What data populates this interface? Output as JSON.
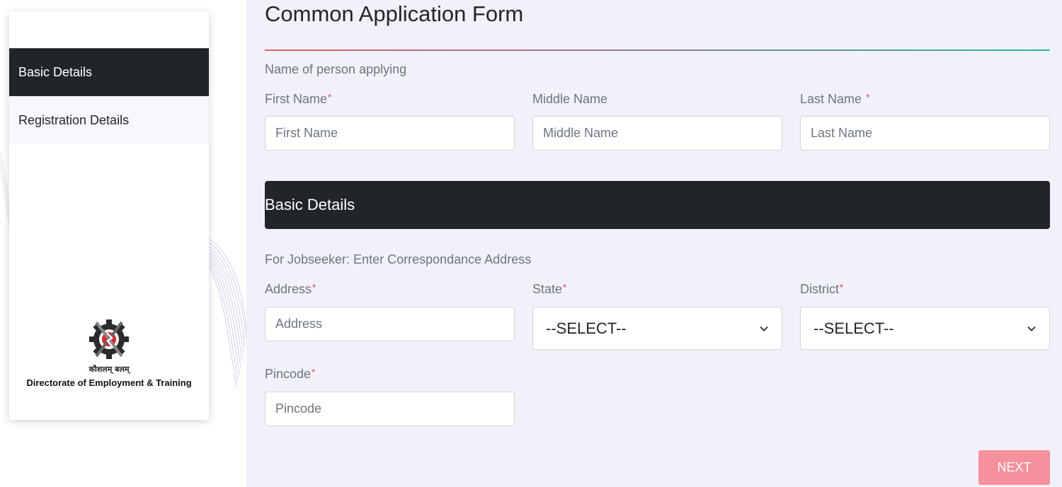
{
  "sidebar": {
    "items": [
      {
        "label": "Basic Details"
      },
      {
        "label": "Registration Details"
      }
    ],
    "logo": {
      "hindi": "कौशलम् बलम्",
      "org": "Directorate of Employment & Training"
    }
  },
  "form": {
    "title": "Common Application Form",
    "name_section_label": "Name of person applying",
    "first_name": {
      "label": "First Name",
      "placeholder": "First Name"
    },
    "middle_name": {
      "label": "Middle Name",
      "placeholder": "Middle Name"
    },
    "last_name": {
      "label": "Last Name",
      "placeholder": "Last Name"
    },
    "basic_details_banner": "Basic Details",
    "address_section_label": "For Jobseeker: Enter Correspondance Address",
    "address": {
      "label": "Address",
      "placeholder": "Address"
    },
    "state": {
      "label": "State",
      "value": "--SELECT--"
    },
    "district": {
      "label": "District",
      "value": "--SELECT--"
    },
    "pincode": {
      "label": "Pincode",
      "placeholder": "Pincode"
    },
    "required_mark": "*",
    "next_label": "NEXT"
  },
  "colors": {
    "dark": "#212529",
    "panel_bg": "#f1f2f9",
    "required": "#dc3545",
    "next_button": "#f5909d"
  }
}
